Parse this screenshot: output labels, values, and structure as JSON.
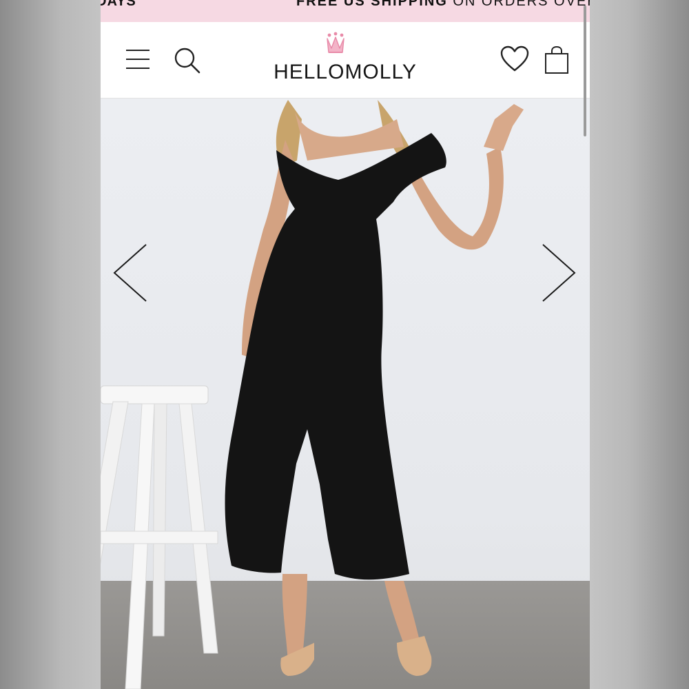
{
  "promo": {
    "left_text": "DAYS",
    "right_bold": "FREE US SHIPPING",
    "right_light": " ON ORDERS OVER"
  },
  "header": {
    "logo_text": "HELLOMOLLY",
    "icons": [
      "menu-icon",
      "search-icon",
      "crown-icon",
      "heart-icon",
      "shopping-bag-icon"
    ]
  },
  "gallery": {
    "prev_icon": "chevron-left-icon",
    "next_icon": "chevron-right-icon"
  },
  "colors": {
    "promo_bg": "#f6d9e3",
    "header_bg": "#ffffff",
    "crown_pink": "#e88aa8",
    "dress": "#141414"
  }
}
